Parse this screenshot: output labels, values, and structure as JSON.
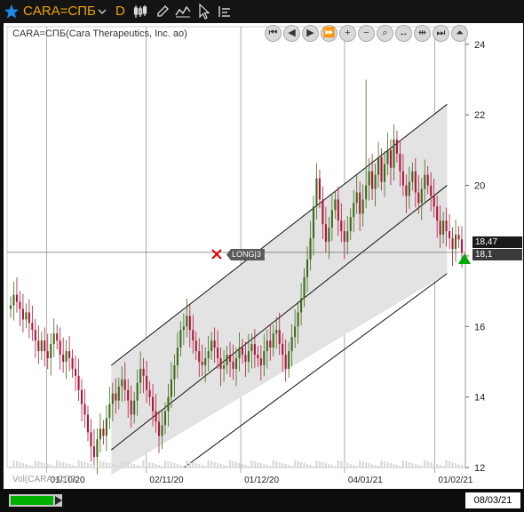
{
  "toolbar": {
    "symbol": "CARA=СПБ",
    "period": "D",
    "icons": [
      "star-icon",
      "chevron-down-icon",
      "candlestick-icon",
      "pencil-icon",
      "indicator-icon",
      "cursor-icon",
      "settings-icon"
    ]
  },
  "chart": {
    "title": "CARA=СПБ(Cara Therapeutics, Inc. ao)",
    "volume_label": "Vol(CARA=СПБ)",
    "price_tag_last": "18,47",
    "price_tag_current": "18,1",
    "order_label": "LONG|3",
    "bottom_date": "08/03/21",
    "nav_icons": [
      "first-icon",
      "prev-icon",
      "play-icon",
      "fast-forward-icon",
      "zoom-in-icon",
      "zoom-out-icon",
      "search-zoom-icon",
      "fit-icon",
      "compress-icon",
      "last-icon",
      "collapse-up-icon"
    ],
    "colors": {
      "up": "#3d6b1a",
      "down": "#b0163a",
      "channel": "#e3e3e3",
      "accent": "#f0a400",
      "green": "#00b000"
    }
  },
  "chart_data": {
    "type": "candlestick",
    "y_ticks": [
      "24",
      "22",
      "20",
      "18",
      "16",
      "14",
      "12"
    ],
    "ylim": [
      12,
      24.5
    ],
    "x_tick_labels": [
      "01/10/20",
      "02/11/20",
      "01/12/20",
      "04/01/21",
      "01/02/21"
    ],
    "x_tick_positions": [
      8,
      30,
      51,
      74,
      94
    ],
    "n_bars": 147,
    "closes": [
      16.6,
      16.9,
      16.7,
      16.5,
      16.2,
      16.4,
      16.1,
      15.9,
      15.6,
      15.3,
      15.6,
      15.3,
      15.1,
      15.5,
      15.8,
      15.6,
      15.2,
      15.0,
      15.3,
      15.1,
      14.8,
      14.6,
      14.2,
      13.8,
      13.5,
      13.0,
      12.6,
      12.3,
      12.8,
      13.1,
      12.9,
      13.4,
      13.8,
      14.1,
      13.9,
      14.3,
      14.5,
      14.2,
      13.9,
      13.5,
      13.9,
      14.4,
      14.8,
      14.6,
      14.2,
      14.0,
      13.6,
      13.3,
      12.9,
      13.2,
      13.6,
      14.0,
      14.5,
      14.9,
      15.4,
      15.9,
      16.0,
      16.3,
      15.9,
      15.6,
      15.3,
      15.0,
      14.9,
      15.1,
      15.3,
      15.6,
      15.4,
      15.1,
      14.8,
      14.9,
      15.2,
      15.0,
      14.8,
      15.1,
      15.4,
      15.2,
      15.0,
      15.3,
      15.5,
      15.2,
      15.1,
      14.9,
      15.3,
      15.6,
      15.4,
      15.8,
      15.9,
      15.5,
      15.2,
      14.8,
      15.3,
      15.7,
      16.0,
      16.4,
      16.8,
      17.4,
      17.9,
      18.5,
      19.4,
      20.2,
      19.6,
      18.9,
      18.4,
      18.8,
      19.3,
      19.6,
      19.0,
      18.7,
      18.4,
      18.7,
      19.1,
      19.5,
      19.8,
      19.2,
      19.6,
      20.0,
      20.4,
      19.9,
      20.3,
      20.8,
      20.1,
      20.6,
      21.0,
      20.5,
      21.3,
      20.9,
      20.4,
      20.0,
      19.7,
      20.1,
      20.4,
      19.8,
      19.5,
      19.9,
      20.3,
      20.0,
      19.7,
      19.4,
      19.0,
      18.6,
      19.0,
      18.7,
      18.5,
      18.2,
      18.6,
      18.47,
      18.1
    ],
    "channel": {
      "upper": [
        [
          116,
          14.9
        ],
        [
          503,
          22.3
        ]
      ],
      "mid": [
        [
          116,
          12.5
        ],
        [
          503,
          20.0
        ]
      ],
      "lower": [
        [
          200,
          12.0
        ],
        [
          503,
          17.5
        ]
      ]
    },
    "price_level": 18.1,
    "spike": {
      "index": 115,
      "high": 23.0
    }
  }
}
